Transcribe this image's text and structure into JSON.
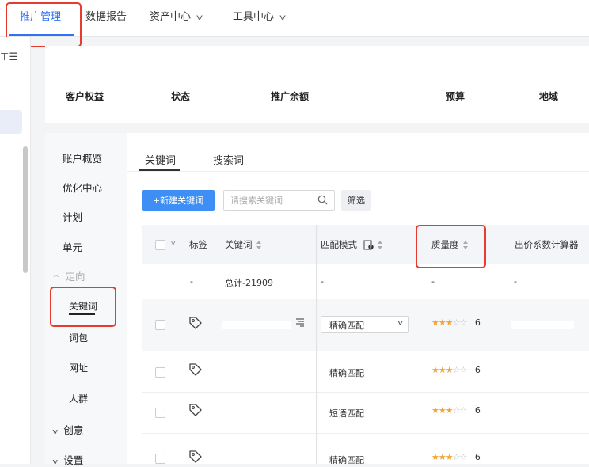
{
  "topnav": {
    "tabs": [
      {
        "label": "推广管理",
        "active": true
      },
      {
        "label": "数据报告"
      },
      {
        "label": "资产中心",
        "chevron": "v"
      },
      {
        "label": "工具中心",
        "chevron": "v"
      }
    ]
  },
  "leftstrip": {
    "icon_glyph": "⊤ ☰"
  },
  "summary": {
    "headers": [
      "客户权益",
      "状态",
      "推广余额",
      "预算",
      "地域"
    ]
  },
  "subnav": {
    "items": [
      "账户概览",
      "优化中心",
      "计划",
      "单元"
    ],
    "targeting_label": "定向",
    "targeting_children": [
      "关键词",
      "词包",
      "网址",
      "人群"
    ],
    "creative_label": "创意",
    "settings_label": "设置",
    "chevron": "v",
    "chevron_up": "^"
  },
  "content_tabs": [
    "关键词",
    "搜索词"
  ],
  "toolbar": {
    "new_keyword_label": "+新建关键词",
    "search_placeholder": "请搜索关键词",
    "search_value": "",
    "filter_label": "筛选"
  },
  "table": {
    "headers": {
      "tag": "标签",
      "keyword": "关键词",
      "match_mode": "匹配模式",
      "quality": "质量度",
      "bid_calculator": "出价系数计算器"
    },
    "total_row": {
      "tag": "-",
      "keyword": "总计-21909",
      "match_mode": "-",
      "quality": "-",
      "bid": "-"
    },
    "rows": [
      {
        "match_mode": "精确匹配",
        "is_dropdown": true,
        "stars": 3,
        "stars_max": 5,
        "quality_score": "6"
      },
      {
        "match_mode": "精确匹配",
        "is_dropdown": false,
        "stars": 3,
        "stars_max": 5,
        "quality_score": "6"
      },
      {
        "match_mode": "短语匹配",
        "is_dropdown": false,
        "stars": 3,
        "stars_max": 5,
        "quality_score": "6"
      },
      {
        "match_mode": "精确匹配",
        "is_dropdown": false,
        "stars": 3,
        "stars_max": 5,
        "quality_score": "6"
      }
    ]
  },
  "colors": {
    "accent": "#3171f4",
    "primary_button": "#3d8ff5",
    "highlight_box": "#e63b2e",
    "star_filled": "#f3a33a"
  }
}
